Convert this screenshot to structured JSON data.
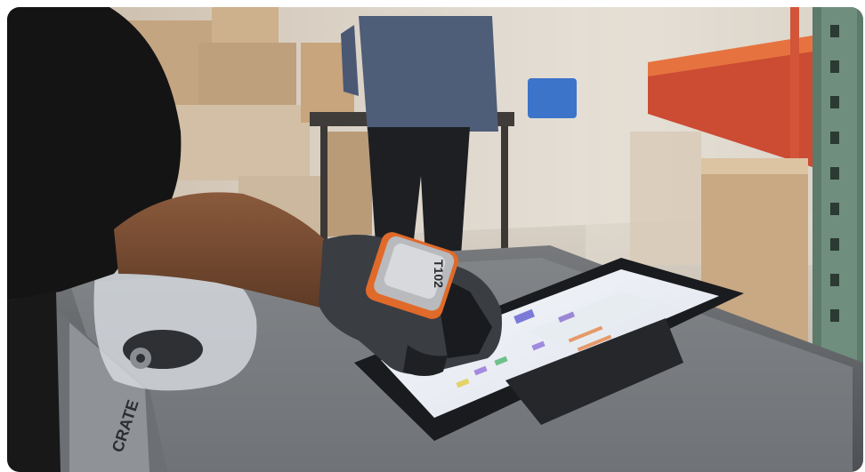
{
  "photo": {
    "scanner_label": "T102",
    "bin_label": "CRATE",
    "colors": {
      "background_wall": "#d8cfc4",
      "floor": "#c7bcae",
      "worker_shirt": "#4e5d78",
      "scanner_orange": "#e06a2a",
      "rack_green": "#5d7a6a",
      "rack_beam": "#d4553a",
      "tablet_screen": "#eef1f6",
      "cart_gray": "#5f6266"
    }
  }
}
